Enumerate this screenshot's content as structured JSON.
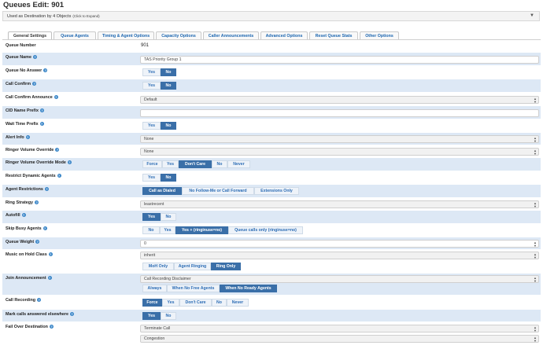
{
  "page": {
    "title": "Queues Edit: 901"
  },
  "destinations": {
    "label": "Used as Destination by 4 Objects",
    "expand": "(Click to Expand)"
  },
  "tabs": [
    {
      "label": "General Settings",
      "active": true
    },
    {
      "label": "Queue Agents"
    },
    {
      "label": "Timing & Agent Options"
    },
    {
      "label": "Capacity Options"
    },
    {
      "label": "Caller Announcements"
    },
    {
      "label": "Advanced Options"
    },
    {
      "label": "Reset Queue Stats"
    },
    {
      "label": "Other Options"
    }
  ],
  "form": {
    "queue_number": {
      "label": "Queue Number",
      "value": "901"
    },
    "queue_name": {
      "label": "Queue Name",
      "value": "TAS Priority Group 1"
    },
    "queue_no_answer": {
      "label": "Queue No Answer",
      "options": [
        "Yes",
        "No"
      ],
      "selected": "No"
    },
    "call_confirm": {
      "label": "Call Confirm",
      "options": [
        "Yes",
        "No"
      ],
      "selected": "No"
    },
    "call_confirm_announce": {
      "label": "Call Confirm Announce",
      "value": "Default"
    },
    "cid_name_prefix": {
      "label": "CID Name Prefix",
      "value": ""
    },
    "wait_time_prefix": {
      "label": "Wait Time Prefix",
      "options": [
        "Yes",
        "No"
      ],
      "selected": "No"
    },
    "alert_info": {
      "label": "Alert Info",
      "value": "None"
    },
    "ringer_volume_override": {
      "label": "Ringer Volume Override",
      "value": "None"
    },
    "ringer_volume_override_mode": {
      "label": "Ringer Volume Override Mode",
      "options": [
        "Force",
        "Yes",
        "Don't Care",
        "No",
        "Never"
      ],
      "selected": "Don't Care"
    },
    "restrict_dynamic_agents": {
      "label": "Restrict Dynamic Agents",
      "options": [
        "Yes",
        "No"
      ],
      "selected": "No"
    },
    "agent_restrictions": {
      "label": "Agent Restrictions",
      "options": [
        "Call as Dialed",
        "No Follow-Me or Call Forward",
        "Extensions Only"
      ],
      "selected": "Call as Dialed"
    },
    "ring_strategy": {
      "label": "Ring Strategy",
      "value": "leastrecent"
    },
    "autofill": {
      "label": "Autofill",
      "options": [
        "Yes",
        "No"
      ],
      "selected": "Yes"
    },
    "skip_busy_agents": {
      "label": "Skip Busy Agents",
      "options": [
        "No",
        "Yes",
        "Yes + (ringinuse=no)",
        "Queue calls only (ringinuse=no)"
      ],
      "selected": "Yes + (ringinuse=no)"
    },
    "queue_weight": {
      "label": "Queue Weight",
      "value": "0"
    },
    "music_on_hold_class": {
      "label": "Music on Hold Class",
      "value": "inherit",
      "options": [
        "MoH Only",
        "Agent Ringing",
        "Ring Only"
      ],
      "selected": "Ring Only"
    },
    "join_announcement": {
      "label": "Join Announcement",
      "value": "Call Recording Disclaimer",
      "options": [
        "Always",
        "When No Free Agents",
        "When No Ready Agents"
      ],
      "selected": "When No Ready Agents"
    },
    "call_recording": {
      "label": "Call Recording",
      "options": [
        "Force",
        "Yes",
        "Don't Care",
        "No",
        "Never"
      ],
      "selected": "Force"
    },
    "mark_calls_answered": {
      "label": "Mark calls answered elsewhere",
      "options": [
        "Yes",
        "No"
      ],
      "selected": "Yes"
    },
    "fail_over_destination": {
      "label": "Fail Over Destination",
      "value": "Terminate Call",
      "value2": "Congestion"
    }
  }
}
